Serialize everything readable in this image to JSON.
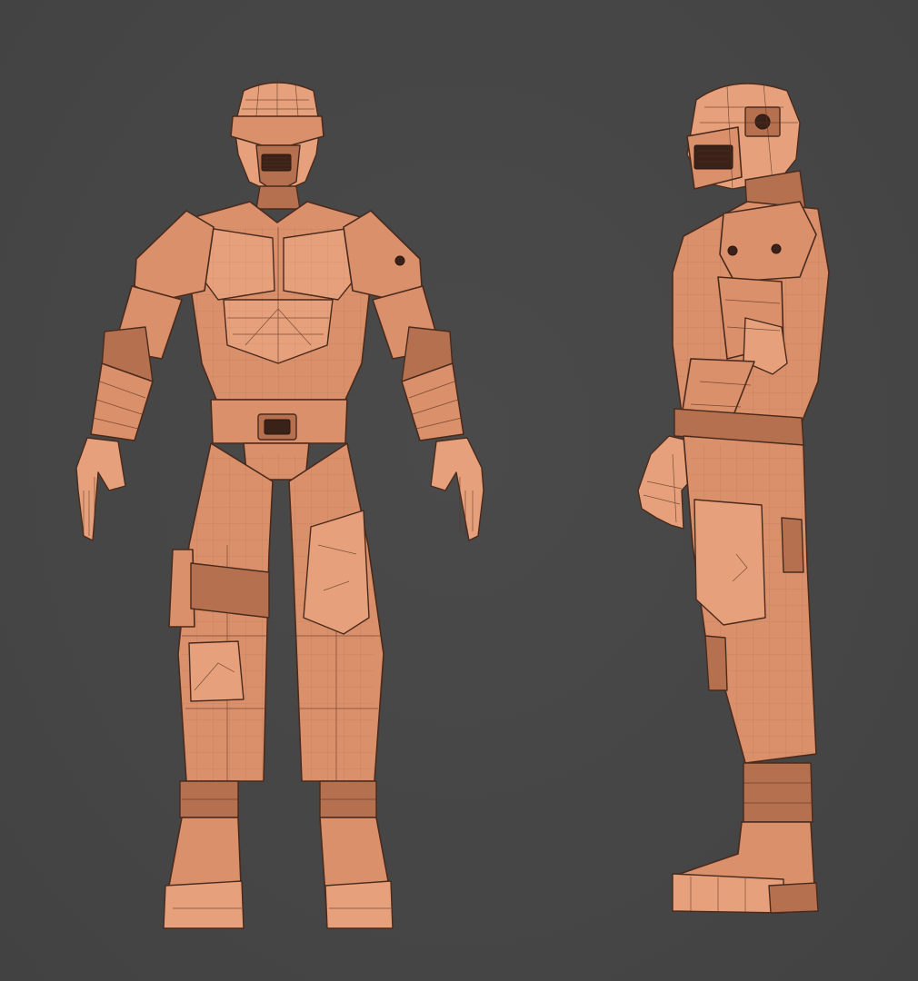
{
  "scene": {
    "background_color": "#474747",
    "model_color": "#d9906b",
    "wire_color": "#5a3222",
    "views": [
      {
        "id": "front",
        "icon": "character-front-view"
      },
      {
        "id": "side",
        "icon": "character-side-view"
      }
    ]
  }
}
